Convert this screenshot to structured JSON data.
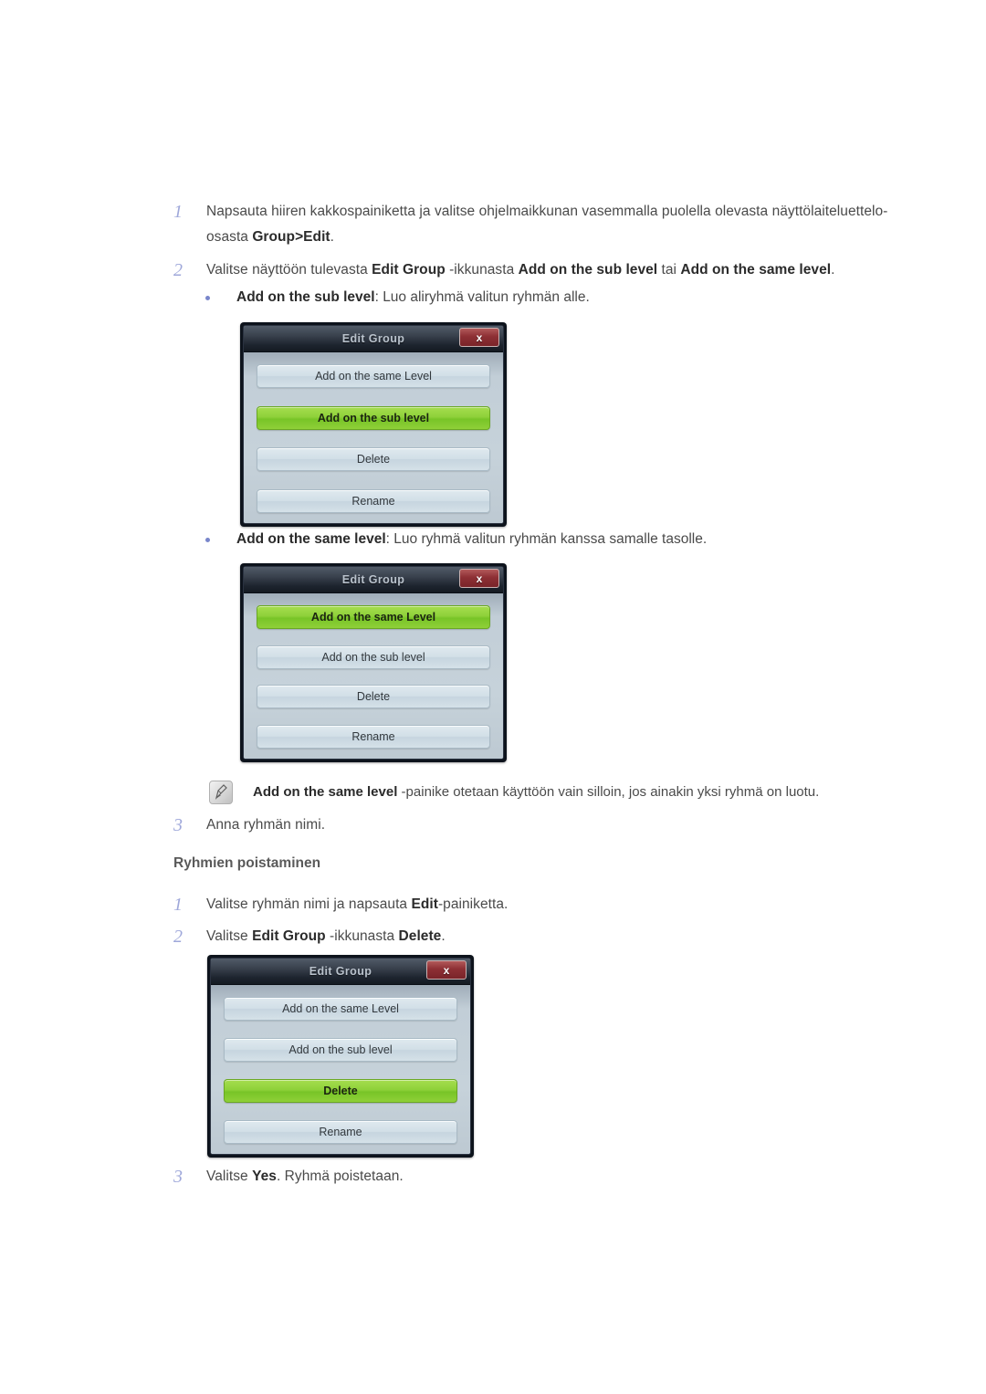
{
  "document": {
    "steps_group_create": [
      {
        "num": "1",
        "parts": [
          {
            "t": "Napsauta hiiren kakkospainiketta ja valitse ohjelmaikkunan vasemmalla puolella olevasta näyttölaiteluettelo-osasta ",
            "b": false
          },
          {
            "t": "Group>Edit",
            "b": true
          },
          {
            "t": ".",
            "b": false
          }
        ]
      },
      {
        "num": "2",
        "parts": [
          {
            "t": "Valitse näyttöön tulevasta ",
            "b": false
          },
          {
            "t": "Edit Group",
            "b": true
          },
          {
            "t": " -ikkunasta ",
            "b": false
          },
          {
            "t": "Add on the sub level",
            "b": true
          },
          {
            "t": " tai ",
            "b": false
          },
          {
            "t": "Add on the same level",
            "b": true
          },
          {
            "t": ".",
            "b": false
          }
        ]
      }
    ],
    "bullet_sub_level": [
      {
        "t": "Add on the sub level",
        "b": true
      },
      {
        "t": ": Luo aliryhmä valitun ryhmän alle.",
        "b": false
      }
    ],
    "bullet_same_level": [
      {
        "t": "Add on the same level",
        "b": true
      },
      {
        "t": ": Luo ryhmä valitun ryhmän kanssa samalle tasolle.",
        "b": false
      }
    ],
    "note": [
      {
        "t": "Add on the same level",
        "b": true
      },
      {
        "t": " -painike otetaan käyttöön vain silloin, jos ainakin yksi ryhmä on luotu.",
        "b": false
      }
    ],
    "note_icon_name": "note-pen-icon",
    "step_3_create": {
      "num": "3",
      "parts": [
        {
          "t": "Anna ryhmän nimi.",
          "b": false
        }
      ]
    },
    "section_heading": "Ryhmien poistaminen",
    "steps_group_delete": [
      {
        "num": "1",
        "parts": [
          {
            "t": "Valitse ryhmän nimi ja napsauta ",
            "b": false
          },
          {
            "t": "Edit",
            "b": true
          },
          {
            "t": "-painiketta.",
            "b": false
          }
        ]
      },
      {
        "num": "2",
        "parts": [
          {
            "t": "Valitse ",
            "b": false
          },
          {
            "t": "Edit Group",
            "b": true
          },
          {
            "t": " -ikkunasta ",
            "b": false
          },
          {
            "t": "Delete",
            "b": true
          },
          {
            "t": ".",
            "b": false
          }
        ]
      }
    ],
    "step_3_delete": {
      "num": "3",
      "parts": [
        {
          "t": "Valitse ",
          "b": false
        },
        {
          "t": "Yes",
          "b": true
        },
        {
          "t": ". Ryhmä poistetaan.",
          "b": false
        }
      ]
    }
  },
  "dialogs": [
    {
      "id": "edit-group-sub-level",
      "title": "Edit Group",
      "close_label": "x",
      "buttons": [
        {
          "label": "Add on the same Level",
          "selected": false
        },
        {
          "label": "Add on the sub level",
          "selected": true
        },
        {
          "label": "Delete",
          "selected": false
        },
        {
          "label": "Rename",
          "selected": false
        }
      ]
    },
    {
      "id": "edit-group-same-level",
      "title": "Edit Group",
      "close_label": "x",
      "buttons": [
        {
          "label": "Add on the same Level",
          "selected": true
        },
        {
          "label": "Add on the sub level",
          "selected": false
        },
        {
          "label": "Delete",
          "selected": false
        },
        {
          "label": "Rename",
          "selected": false
        }
      ]
    },
    {
      "id": "edit-group-delete",
      "title": "Edit Group",
      "close_label": "x",
      "buttons": [
        {
          "label": "Add on the same Level",
          "selected": false
        },
        {
          "label": "Add on the sub level",
          "selected": false
        },
        {
          "label": "Delete",
          "selected": true
        },
        {
          "label": "Rename",
          "selected": false
        }
      ]
    }
  ],
  "colors": {
    "step_number": "#9FA8DA",
    "bullet_dot": "#7986CB",
    "body_text": "#4a4a4a",
    "bold_text": "#2b2b2b",
    "dialog_selected_green": "#8ed13a",
    "dialog_close_red": "#8d2f34",
    "dialog_body_bg": "#c6d2da",
    "dialog_title_bg": "#1d242e"
  }
}
